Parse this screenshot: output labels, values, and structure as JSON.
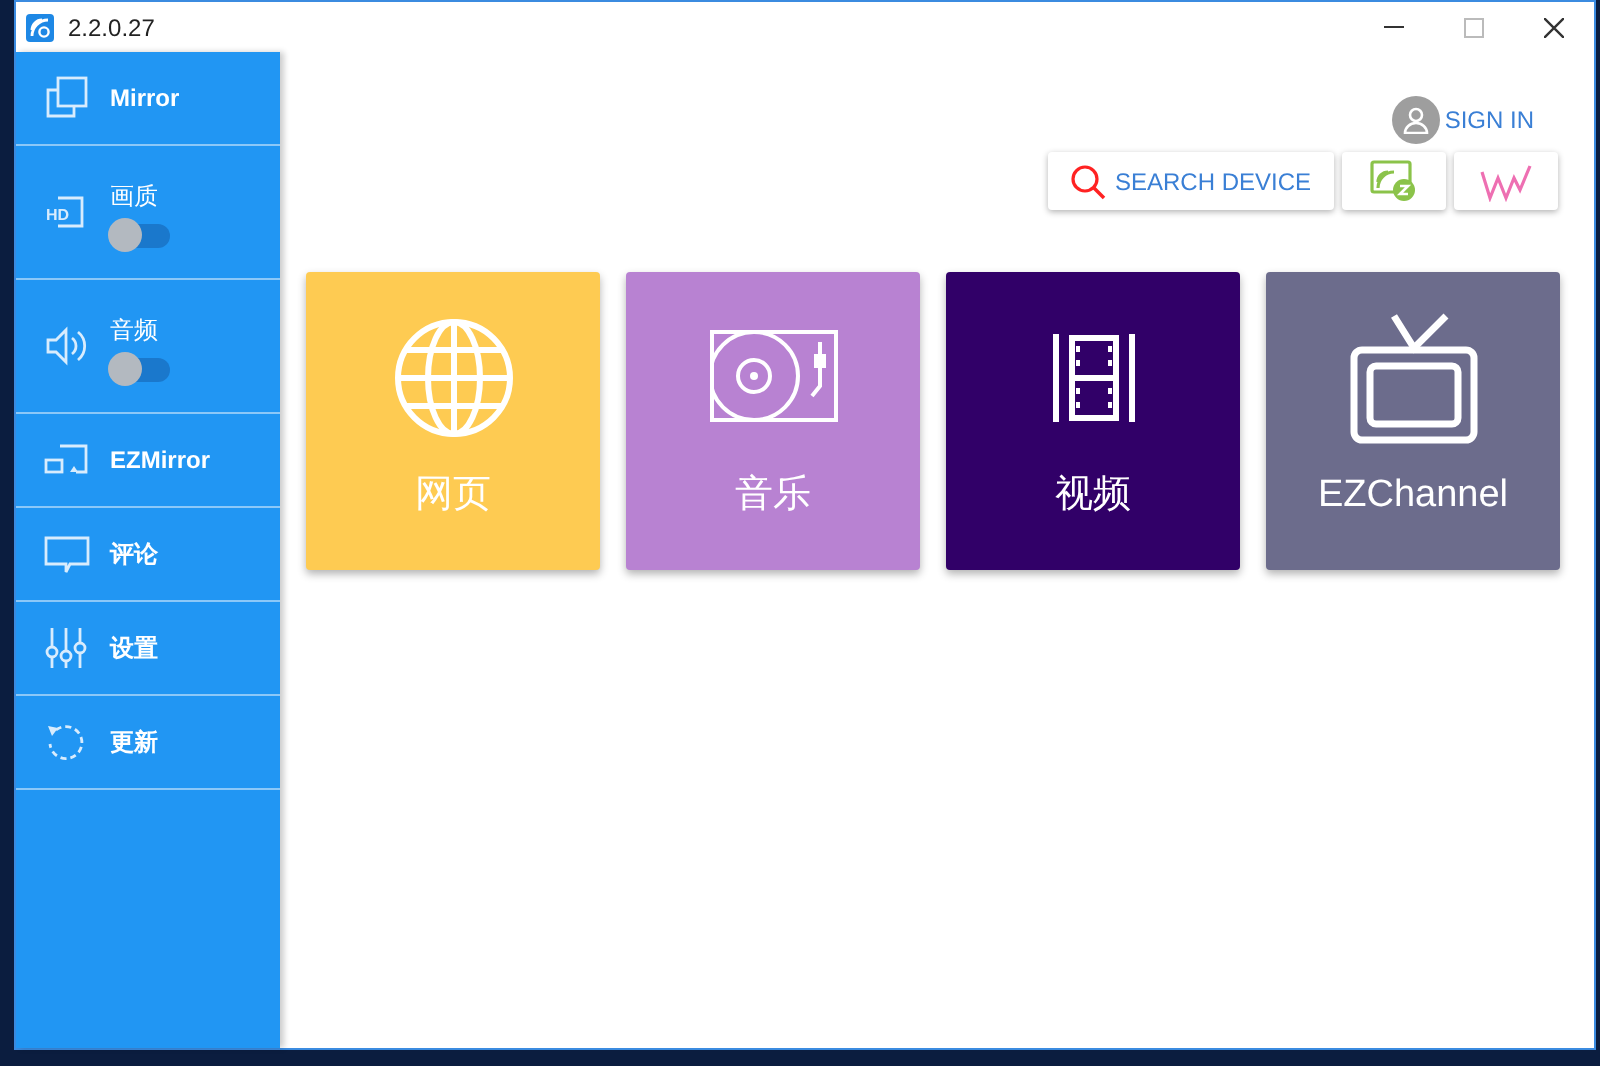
{
  "window": {
    "title": "2.2.0.27"
  },
  "sidebar": {
    "items": [
      {
        "kind": "link",
        "label": "Mirror"
      },
      {
        "kind": "toggle",
        "label": "画质",
        "on": false,
        "icon_text": "HD"
      },
      {
        "kind": "toggle",
        "label": "音频",
        "on": false
      },
      {
        "kind": "link",
        "label": "EZMirror"
      },
      {
        "kind": "link",
        "label": "评论"
      },
      {
        "kind": "link",
        "label": "设置"
      },
      {
        "kind": "link",
        "label": "更新"
      }
    ]
  },
  "header": {
    "sign_in": "SIGN IN",
    "search_button": "SEARCH DEVICE"
  },
  "tiles": [
    {
      "label": "网页",
      "color": "#fecb52"
    },
    {
      "label": "音乐",
      "color": "#b882d2"
    },
    {
      "label": "视频",
      "color": "#310068"
    },
    {
      "label": "EZChannel",
      "color": "#6c6c8c"
    }
  ]
}
